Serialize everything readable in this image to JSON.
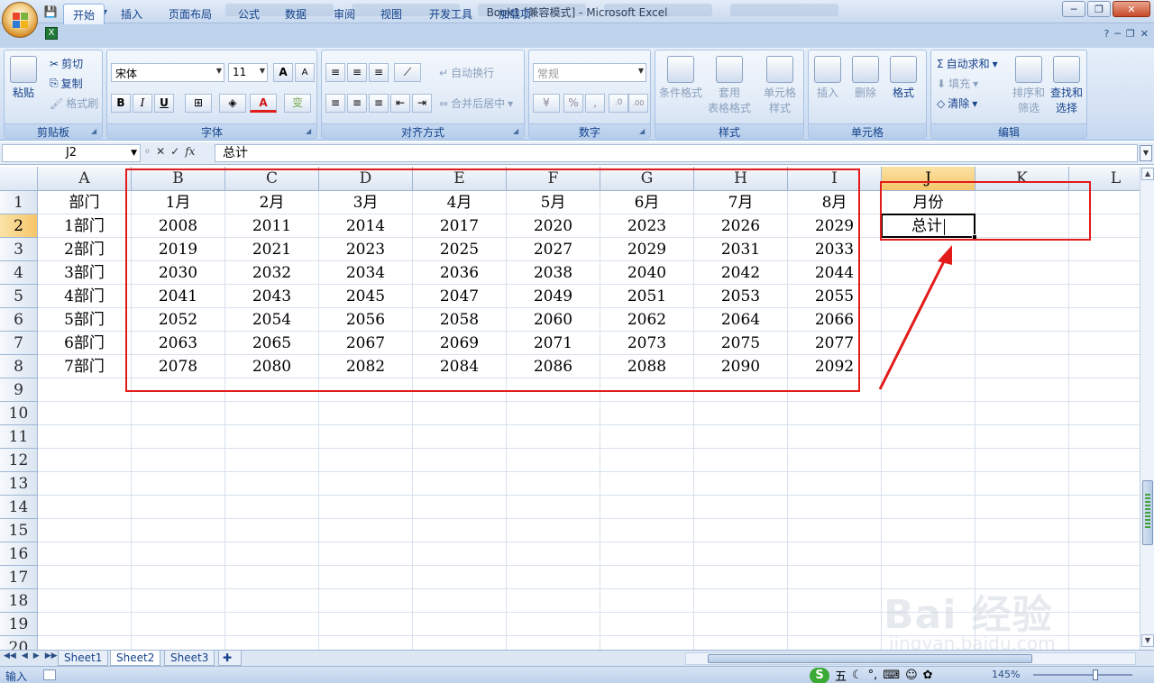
{
  "title": {
    "text": "Book1  [兼容模式] - Microsoft Excel"
  },
  "qat": {
    "save": "💾",
    "undo": "↶",
    "redo": "↷",
    "customize": "▾"
  },
  "window_controls": {
    "minimize": "─",
    "restore": "❐",
    "close": "✕"
  },
  "ribbon_tabs": [
    "开始",
    "插入",
    "页面布局",
    "公式",
    "数据",
    "审阅",
    "视图",
    "开发工具",
    "加载项"
  ],
  "ribbon": {
    "clipboard": {
      "label": "剪贴板",
      "paste": "粘贴",
      "cut": "剪切",
      "copy": "复制",
      "format_painter": "格式刷"
    },
    "font": {
      "label": "字体",
      "font_name": "宋体",
      "font_size": "11",
      "bold": "B",
      "italic": "I",
      "underline": "U",
      "grow": "A",
      "shrink": "A",
      "font_color": "A",
      "phonetic": "变"
    },
    "alignment": {
      "label": "对齐方式",
      "wrap": "自动换行",
      "merge": "合并后居中"
    },
    "number": {
      "label": "数字",
      "format": "常规",
      "percent": "%",
      "comma": ",",
      "inc_decimal": ".0",
      "dec_decimal": ".00"
    },
    "styles": {
      "label": "样式",
      "conditional": "条件格式",
      "table_l1": "套用",
      "table_l2": "表格格式",
      "cell_style_l1": "单元格",
      "cell_style_l2": "样式"
    },
    "cells": {
      "label": "单元格",
      "insert": "插入",
      "delete": "删除",
      "format": "格式"
    },
    "editing": {
      "label": "编辑",
      "autosum": "自动求和",
      "fill": "填充",
      "clear": "清除",
      "sort_l1": "排序和",
      "sort_l2": "筛选",
      "find_l1": "查找和",
      "find_l2": "选择"
    }
  },
  "formula_bar": {
    "name_box": "J2",
    "content": "总计"
  },
  "grid": {
    "columns": [
      "A",
      "B",
      "C",
      "D",
      "E",
      "F",
      "G",
      "H",
      "I",
      "J",
      "K",
      "L"
    ],
    "rows": [
      "1",
      "2",
      "3",
      "4",
      "5",
      "6",
      "7",
      "8",
      "9",
      "10",
      "11",
      "12",
      "13",
      "14",
      "15",
      "16",
      "17",
      "18",
      "19",
      "20"
    ],
    "cells": [
      [
        "部门",
        "1月",
        "2月",
        "3月",
        "4月",
        "5月",
        "6月",
        "7月",
        "8月",
        "月份",
        "",
        ""
      ],
      [
        "1部门",
        "2008",
        "2011",
        "2014",
        "2017",
        "2020",
        "2023",
        "2026",
        "2029",
        "总计",
        "",
        ""
      ],
      [
        "2部门",
        "2019",
        "2021",
        "2023",
        "2025",
        "2027",
        "2029",
        "2031",
        "2033",
        "",
        "",
        ""
      ],
      [
        "3部门",
        "2030",
        "2032",
        "2034",
        "2036",
        "2038",
        "2040",
        "2042",
        "2044",
        "",
        "",
        ""
      ],
      [
        "4部门",
        "2041",
        "2043",
        "2045",
        "2047",
        "2049",
        "2051",
        "2053",
        "2055",
        "",
        "",
        ""
      ],
      [
        "5部门",
        "2052",
        "2054",
        "2056",
        "2058",
        "2060",
        "2062",
        "2064",
        "2066",
        "",
        "",
        ""
      ],
      [
        "6部门",
        "2063",
        "2065",
        "2067",
        "2069",
        "2071",
        "2073",
        "2075",
        "2077",
        "",
        "",
        ""
      ],
      [
        "7部门",
        "2078",
        "2080",
        "2082",
        "2084",
        "2086",
        "2088",
        "2090",
        "2092",
        "",
        "",
        ""
      ]
    ],
    "active_cell": "J2",
    "selected_column": "J",
    "selected_row": "2"
  },
  "sheets": {
    "tabs": [
      "Sheet1",
      "Sheet2",
      "Sheet3"
    ],
    "active": "Sheet2"
  },
  "status": {
    "mode": "输入",
    "zoom": "145%",
    "ime_label": "五"
  },
  "annotation_color": "#e21b1b",
  "watermark": {
    "main": "Bai 经验",
    "sub": "jingyan.baidu.com"
  }
}
